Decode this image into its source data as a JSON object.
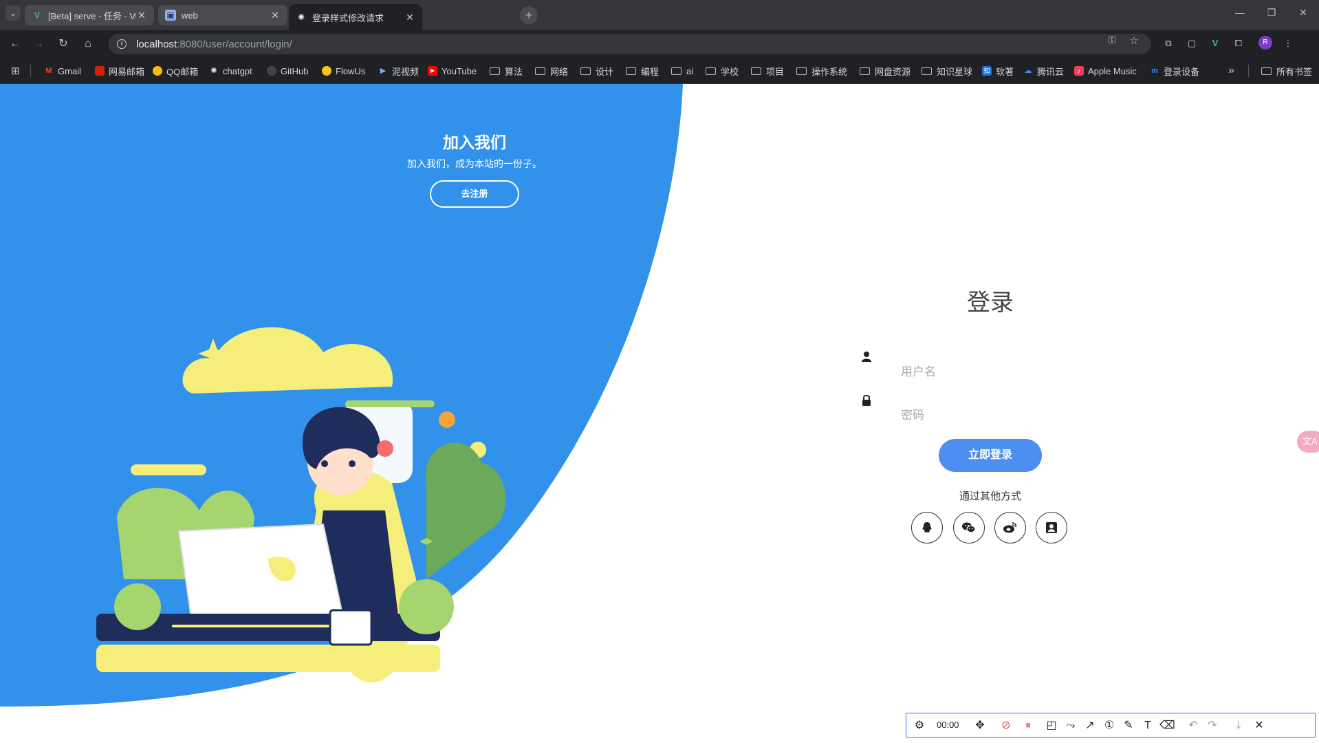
{
  "browser": {
    "tabs": [
      {
        "title": "[Beta] serve - 任务 - Vue CLI",
        "favicon": "V",
        "active": false
      },
      {
        "title": "web",
        "favicon": "web-cube",
        "active": false
      },
      {
        "title": "登录样式修改请求",
        "favicon": "chatgpt",
        "active": true
      }
    ],
    "url_host": "localhost",
    "url_path": ":8080/user/account/login/",
    "bookmarks": [
      {
        "label": "Gmail",
        "icon": "gmail-icon"
      },
      {
        "label": "网易邮箱",
        "icon": "netease-icon"
      },
      {
        "label": "QQ邮箱",
        "icon": "qqmail-icon"
      },
      {
        "label": "chatgpt",
        "icon": "chatgpt-icon"
      },
      {
        "label": "GitHub",
        "icon": "github-icon"
      },
      {
        "label": "FlowUs",
        "icon": "flowus-icon"
      },
      {
        "label": "泥视频",
        "icon": "play-icon"
      },
      {
        "label": "YouTube",
        "icon": "youtube-icon"
      },
      {
        "label": "算法",
        "icon": "folder-icon"
      },
      {
        "label": "网络",
        "icon": "folder-icon"
      },
      {
        "label": "设计",
        "icon": "folder-icon"
      },
      {
        "label": "编程",
        "icon": "folder-icon"
      },
      {
        "label": "ai",
        "icon": "folder-icon"
      },
      {
        "label": "学校",
        "icon": "folder-icon"
      },
      {
        "label": "项目",
        "icon": "folder-icon"
      },
      {
        "label": "操作系统",
        "icon": "folder-icon"
      },
      {
        "label": "网盘资源",
        "icon": "folder-icon"
      },
      {
        "label": "知识星球",
        "icon": "folder-icon"
      },
      {
        "label": "软著",
        "icon": "zhi-icon"
      },
      {
        "label": "腾讯云",
        "icon": "cloud-icon"
      },
      {
        "label": "Apple Music",
        "icon": "music-icon"
      },
      {
        "label": "登录设备",
        "icon": "mi-icon"
      }
    ],
    "all_bookmarks": "所有书签"
  },
  "page": {
    "join_title": "加入我们",
    "join_subtitle": "加入我们，成为本站的一份子。",
    "join_button": "去注册",
    "login_title": "登录",
    "username_placeholder": "用户名",
    "password_placeholder": "密码",
    "login_button": "立即登录",
    "other_methods": "通过其他方式",
    "social": [
      "qq-icon",
      "wechat-icon",
      "weibo-icon",
      "face-login-icon"
    ],
    "accent_blue": "#3191eb",
    "button_blue": "#4d8ef0"
  },
  "screenshot_toolbar": {
    "timer": "00:00"
  }
}
